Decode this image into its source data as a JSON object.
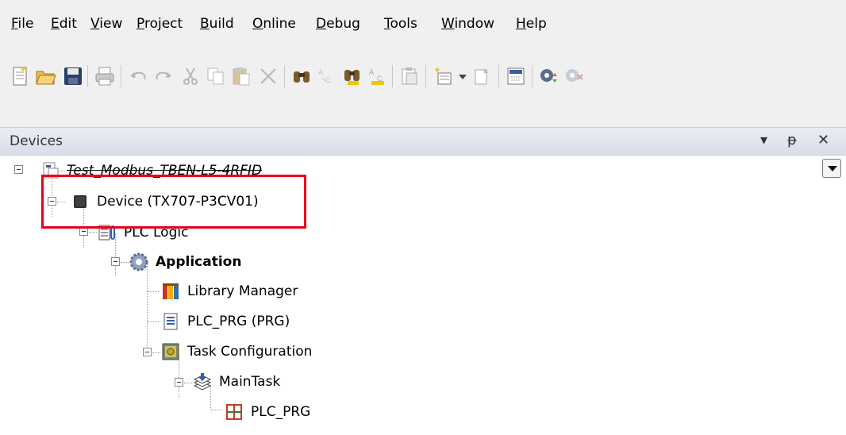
{
  "menu": {
    "file": {
      "mn": "F",
      "rest": "ile"
    },
    "edit": {
      "mn": "E",
      "rest": "dit"
    },
    "view": {
      "mn": "V",
      "rest": "iew"
    },
    "project": {
      "mn": "P",
      "rest": "roject"
    },
    "build": {
      "mn": "B",
      "rest": "uild"
    },
    "online": {
      "mn": "O",
      "rest": "nline"
    },
    "debug": {
      "mn": "D",
      "rest": "ebug"
    },
    "tools": {
      "mn": "T",
      "rest": "ools"
    },
    "window": {
      "mn": "W",
      "rest": "indow"
    },
    "help": {
      "mn": "H",
      "rest": "elp"
    }
  },
  "toolbar_icons": [
    "new-project-icon",
    "open-folder-icon",
    "save-icon",
    "print-icon",
    "undo-icon",
    "redo-icon",
    "cut-icon",
    "copy-icon",
    "paste-icon",
    "delete-icon",
    "find-icon",
    "find-replace-icon",
    "find-next-icon",
    "find-previous-icon",
    "clipboard-icon",
    "add-object-icon",
    "insert-object-icon",
    "build-icon",
    "login-icon",
    "logout-icon"
  ],
  "panel": {
    "title": "Devices",
    "dropdown_glyph": "▾",
    "pin_glyph": "ᵽ",
    "close_glyph": "✕"
  },
  "tree": {
    "project": "Test_Modbus_TBEN-L5-4RFID",
    "device": "Device (TX707-P3CV01)",
    "plc_logic": "PLC Logic",
    "application": "Application",
    "library_manager": "Library Manager",
    "plc_prg": "PLC_PRG (PRG)",
    "task_configuration": "Task Configuration",
    "main_task": "MainTask",
    "plc_prg_call": "PLC_PRG"
  },
  "colors": {
    "highlight": "#e8001c",
    "accent": "#2f5fb3"
  }
}
